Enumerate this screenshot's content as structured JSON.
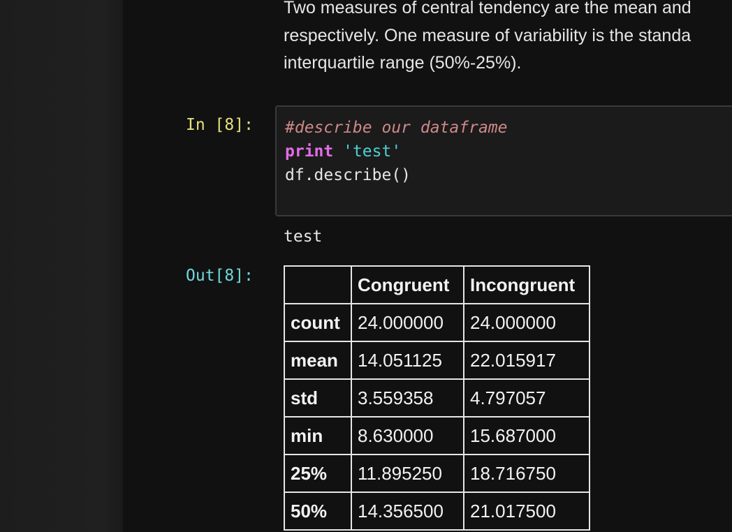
{
  "markdown": {
    "lines": [
      "Two measures of central tendency are the mean and",
      "respectively. One measure of variability is the standa",
      "interquartile range (50%-25%)."
    ]
  },
  "cell": {
    "in_prompt": "In [8]:",
    "out_prompt": "Out[8]:",
    "code": {
      "comment": "#describe our dataframe",
      "keyword": "print",
      "string": "'test'",
      "call": "df.describe()"
    },
    "stdout": "test"
  },
  "table": {
    "corner": "",
    "columns": [
      "Congruent",
      "Incongruent"
    ],
    "rows": [
      {
        "label": "count",
        "values": [
          "24.000000",
          "24.000000"
        ]
      },
      {
        "label": "mean",
        "values": [
          "14.051125",
          "22.015917"
        ]
      },
      {
        "label": "std",
        "values": [
          "3.559358",
          "4.797057"
        ]
      },
      {
        "label": "min",
        "values": [
          "8.630000",
          "15.687000"
        ]
      },
      {
        "label": "25%",
        "values": [
          "11.895250",
          "18.716750"
        ]
      },
      {
        "label": "50%",
        "values": [
          "14.356500",
          "21.017500"
        ]
      }
    ]
  },
  "colors": {
    "background": "#111111",
    "in_prompt": "#e5e07e",
    "out_prompt": "#6ed8de",
    "comment": "#cf8888",
    "keyword": "#e26de5",
    "string": "#4fcfd3"
  }
}
